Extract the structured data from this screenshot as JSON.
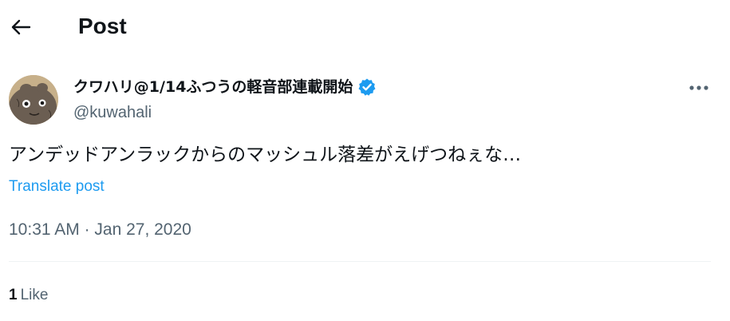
{
  "header": {
    "title": "Post",
    "back_icon": "arrow-left-icon"
  },
  "post": {
    "author": {
      "display_name": "クワハリ@1/14ふつうの軽音部連載開始",
      "handle": "@kuwahali",
      "verified": true,
      "verified_color": "#1d9bf0"
    },
    "text": "アンデッドアンラックからのマッシュル落差がえげつねぇな…",
    "translate_label": "Translate post",
    "time": "10:31 AM",
    "separator": " · ",
    "date": "Jan 27, 2020",
    "likes": {
      "count": "1",
      "label": "Like"
    }
  },
  "colors": {
    "text": "#0f1419",
    "secondary": "#536471",
    "link": "#1d9bf0",
    "divider": "#eff3f4"
  }
}
